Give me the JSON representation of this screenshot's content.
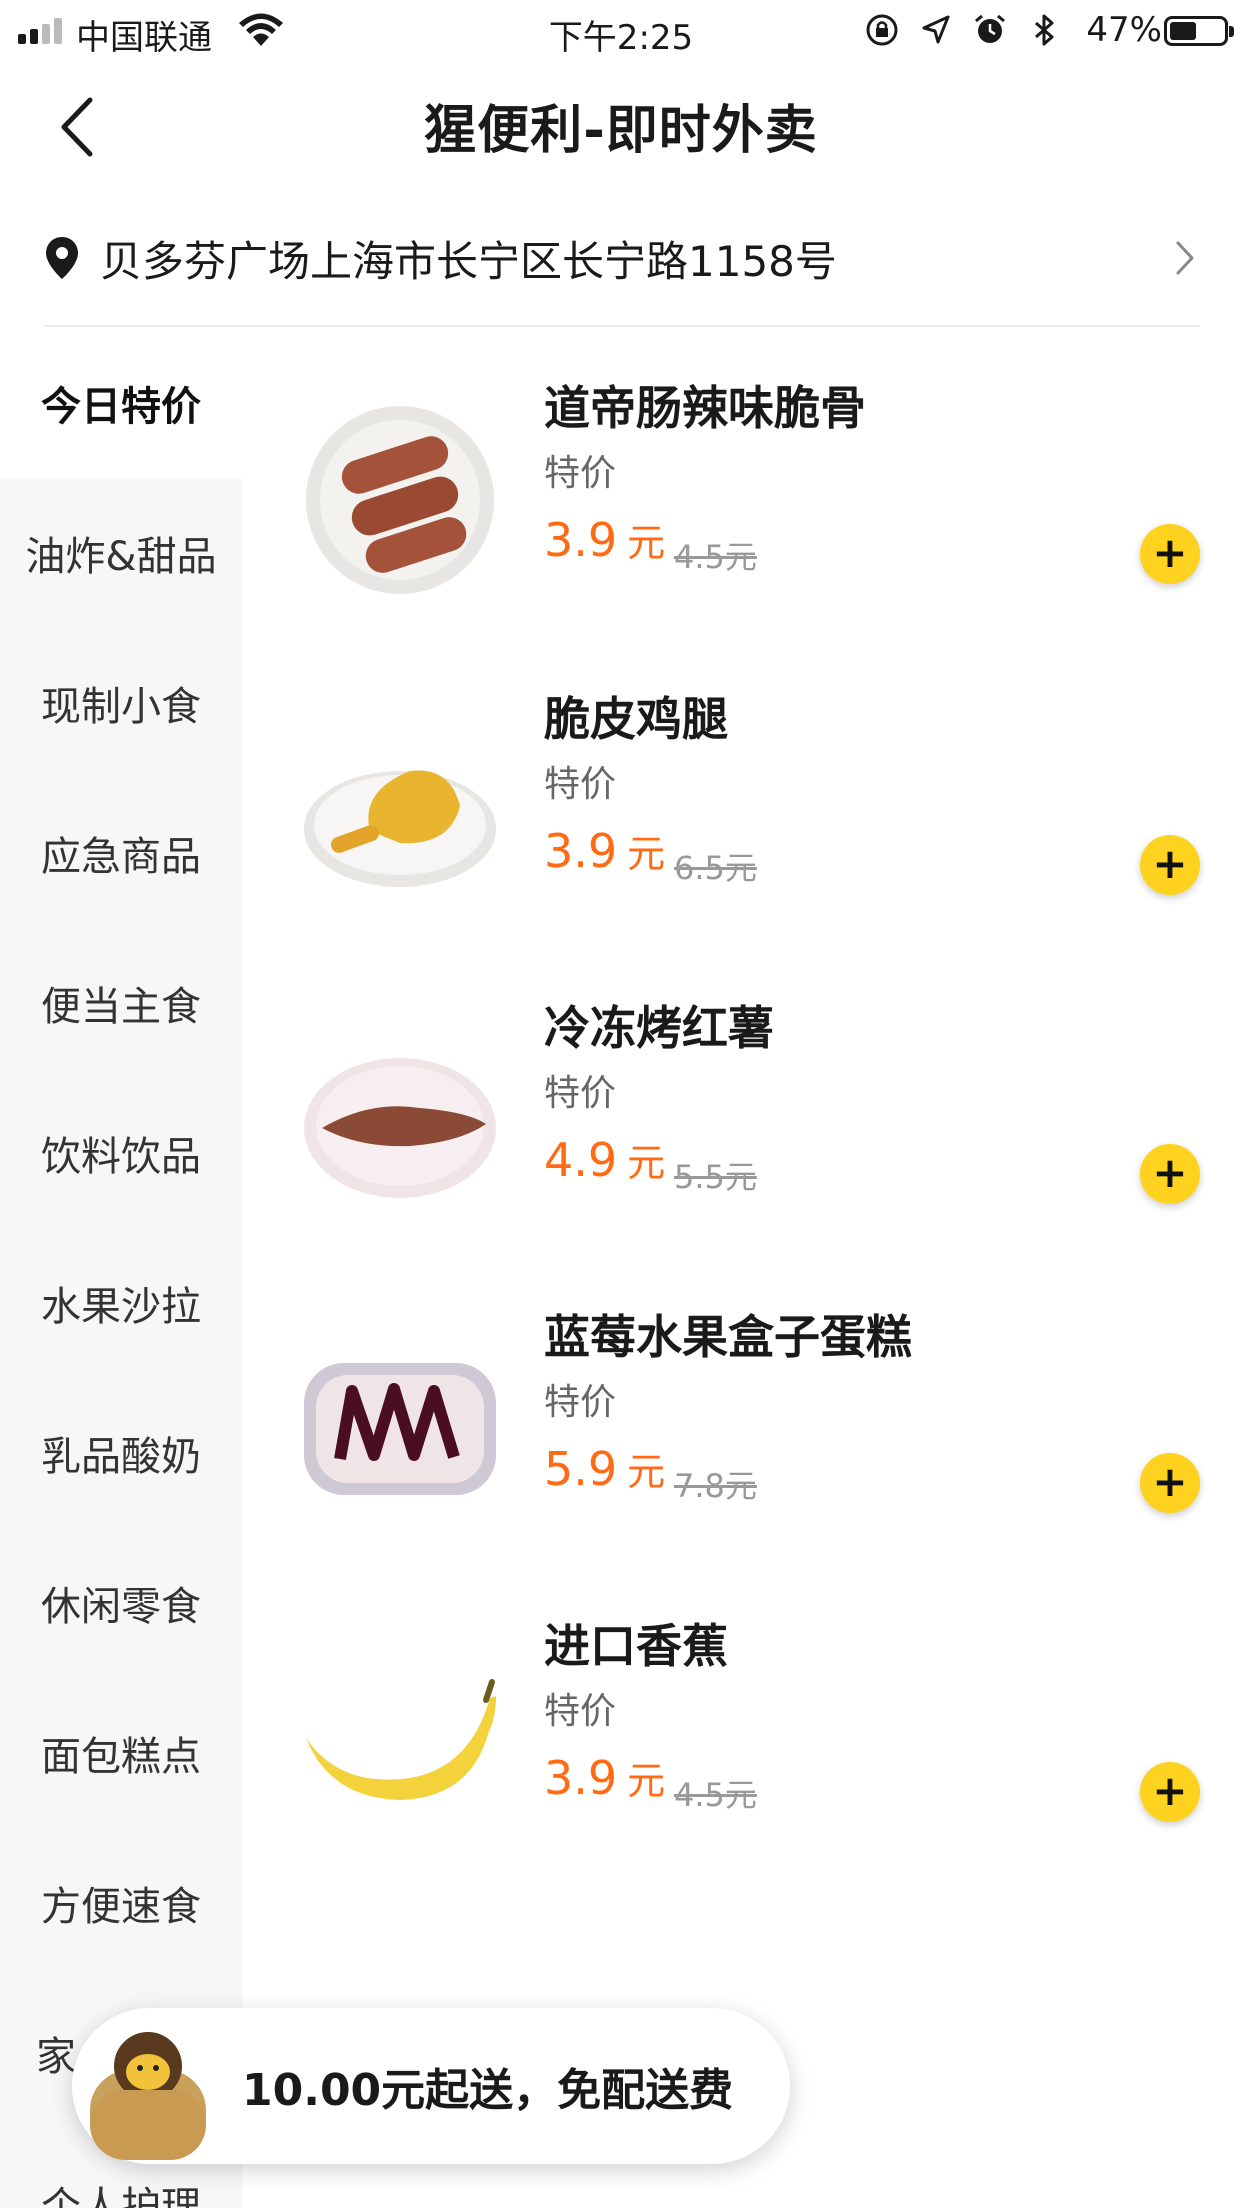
{
  "status_bar": {
    "carrier": "中国联通",
    "time": "下午2:25",
    "battery": "47%",
    "battery_level": 0.47
  },
  "nav": {
    "title": "猩便利-即时外卖"
  },
  "address": {
    "text": "贝多芬广场上海市长宁区长宁路1158号"
  },
  "sidebar": {
    "items": [
      {
        "label": "今日特价",
        "active": true
      },
      {
        "label": "油炸&甜品"
      },
      {
        "label": "现制小食"
      },
      {
        "label": "应急商品"
      },
      {
        "label": "便当主食"
      },
      {
        "label": "饮料饮品"
      },
      {
        "label": "水果沙拉"
      },
      {
        "label": "乳品酸奶"
      },
      {
        "label": "休闲零食"
      },
      {
        "label": "面包糕点"
      },
      {
        "label": "方便速食"
      },
      {
        "label": "家"
      },
      {
        "label": "个人护理"
      }
    ]
  },
  "products": [
    {
      "name": "道帝肠辣味脆骨",
      "tag": "特价",
      "price": "3.9",
      "unit": "元",
      "original": "4.5元",
      "image": "sausage-image"
    },
    {
      "name": "脆皮鸡腿",
      "tag": "特价",
      "price": "3.9",
      "unit": "元",
      "original": "6.5元",
      "image": "chicken-leg-image"
    },
    {
      "name": "冷冻烤红薯",
      "tag": "特价",
      "price": "4.9",
      "unit": "元",
      "original": "5.5元",
      "image": "sweet-potato-image"
    },
    {
      "name": "蓝莓水果盒子蛋糕",
      "tag": "特价",
      "price": "5.9",
      "unit": "元",
      "original": "7.8元",
      "image": "blueberry-cake-image"
    },
    {
      "name": "进口香蕉",
      "tag": "特价",
      "price": "3.9",
      "unit": "元",
      "original": "4.5元",
      "image": "banana-image"
    }
  ],
  "cart_bar": {
    "message": "10.00元起送，免配送费"
  },
  "colors": {
    "accent_price": "#ff6a13",
    "add_button": "#ffd21f",
    "sidebar_bg": "#f7f7f7"
  }
}
